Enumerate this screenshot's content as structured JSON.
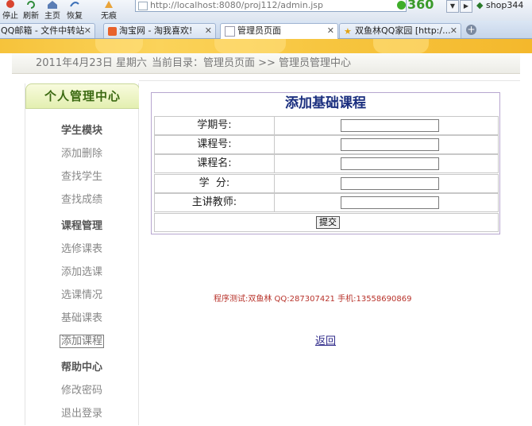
{
  "toolbar": {
    "stop": "停止",
    "refresh": "刷新",
    "home": "主页",
    "restore": "恢复",
    "no_trace": "无痕",
    "address": "http://localhost:8080/proj112/admin.jsp",
    "brand": "360",
    "shop": "shop344"
  },
  "tabs": [
    {
      "label": "QQ邮箱 - 文件中转站"
    },
    {
      "label": "淘宝网 - 淘我喜欢!"
    },
    {
      "label": "管理员页面"
    },
    {
      "label": "双鱼林QQ家园 [http:/..."
    }
  ],
  "datebar": {
    "date": "2011年4月23日 星期六",
    "crumb": "当前目录：管理员页面 >> 管理员管理中心"
  },
  "sidebar": {
    "title": "个人管理中心",
    "student_head": "学生模块",
    "student_items": [
      "添加删除",
      "查找学生",
      "查找成绩"
    ],
    "course_head": "课程管理",
    "course_items": [
      "选修课表",
      "添加选课",
      "选课情况",
      "基础课表",
      "添加课程"
    ],
    "help_head": "帮助中心",
    "help_items": [
      "修改密码",
      "退出登录"
    ]
  },
  "form": {
    "title": "添加基础课程",
    "fields": [
      {
        "label": "学期号:",
        "value": ""
      },
      {
        "label": "课程号:",
        "value": ""
      },
      {
        "label": "课程名:",
        "value": ""
      },
      {
        "label": "学  分:",
        "value": ""
      },
      {
        "label": "主讲教师:",
        "value": ""
      }
    ],
    "submit": "提交"
  },
  "credit": "程序测试:双鱼林 QQ:287307421 手机:13558690869",
  "back": "返回",
  "colors": {
    "banner": "#f6c33b",
    "title": "#1b2f7f",
    "credit": "#b8332b",
    "link": "#2f2a8a"
  }
}
